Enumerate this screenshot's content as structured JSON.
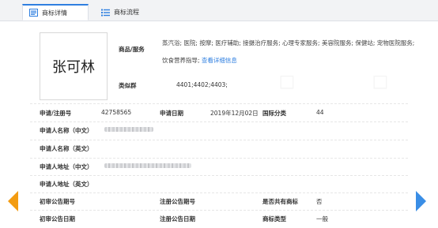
{
  "tabs": [
    {
      "label": "商标详情",
      "icon": "detail-icon"
    },
    {
      "label": "商标流程",
      "icon": "list-icon"
    }
  ],
  "logo_text": "张可林",
  "goods_services": {
    "label": "商品/服务",
    "text": "蒸汽浴; 医院; 按摩; 医疗辅助; 接摄治疗服务; 心理专家服务; 美容院服务; 保健站; 宠物医院服务; 饮食营养指导;",
    "link": "查看详细信息"
  },
  "similar_group": {
    "label": "类似群",
    "value": "4401;4402;4403;"
  },
  "fields": {
    "reg_no_label": "申请/注册号",
    "reg_no": "42758565",
    "apply_date_label": "申请日期",
    "apply_date": "2019年12月02日",
    "intl_class_label": "国际分类",
    "intl_class": "44",
    "applicant_cn_label": "申请人名称（中文）",
    "applicant_en_label": "申请人名称（英文）",
    "address_cn_label": "申请人地址（中文）",
    "address_en_label": "申请人地址（英文）",
    "prelim_no_label": "初审公告期号",
    "reg_notice_no_label": "注册公告期号",
    "shared_label": "是否共有商标",
    "shared_value": "否",
    "prelim_date_label": "初审公告日期",
    "reg_notice_date_label": "注册公告日期",
    "type_label": "商标类型",
    "type_value": "一般"
  },
  "colors": {
    "accent": "#2f7fe0",
    "prev_arrow": "#f39c12",
    "next_arrow": "#3a8ee6"
  }
}
